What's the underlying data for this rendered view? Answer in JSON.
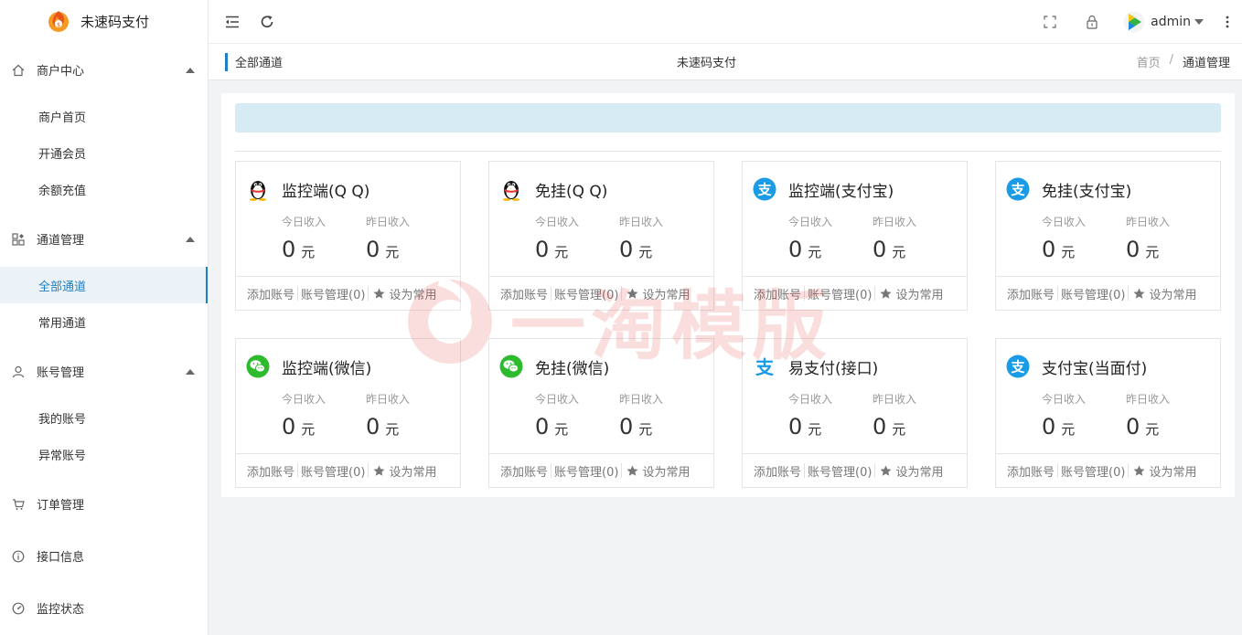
{
  "brand": {
    "name": "未速码支付",
    "logo": "flame-coin-logo"
  },
  "sidebar": {
    "groups": [
      {
        "label": "商户中心",
        "icon": "home-icon",
        "items": [
          "商户首页",
          "开通会员",
          "余额充值"
        ]
      },
      {
        "label": "通道管理",
        "icon": "grid-icon",
        "items": [
          "全部通道",
          "常用通道"
        ]
      },
      {
        "label": "账号管理",
        "icon": "user-icon",
        "items": [
          "我的账号",
          "异常账号"
        ]
      },
      {
        "label": "订单管理",
        "icon": "cart-icon"
      },
      {
        "label": "接口信息",
        "icon": "info-icon"
      },
      {
        "label": "监控状态",
        "icon": "gauge-icon"
      }
    ],
    "active_item": "全部通道"
  },
  "topbar": {
    "user": "admin",
    "icons": [
      "menu-fold-icon",
      "refresh-icon",
      "fullscreen-icon",
      "lock-icon",
      "more-vertical-icon"
    ]
  },
  "crumbbar": {
    "tag": "全部通道",
    "center_title": "未速码支付",
    "breadcrumb": [
      "首页",
      "通道管理"
    ],
    "separator": "/"
  },
  "card_labels": {
    "today": "今日收入",
    "yesterday": "昨日收入",
    "unit": "元",
    "add": "添加账号",
    "manage": "账号管理(0)",
    "favorite": "设为常用"
  },
  "cards": [
    {
      "title": "监控端(Q Q)",
      "icon": "qq-penguin-icon",
      "today": "0",
      "yesterday": "0"
    },
    {
      "title": "免挂(Q Q)",
      "icon": "qq-penguin-icon",
      "today": "0",
      "yesterday": "0"
    },
    {
      "title": "监控端(支付宝)",
      "icon": "alipay-icon",
      "today": "0",
      "yesterday": "0"
    },
    {
      "title": "免挂(支付宝)",
      "icon": "alipay-icon",
      "today": "0",
      "yesterday": "0"
    },
    {
      "title": "监控端(微信)",
      "icon": "wechat-icon",
      "today": "0",
      "yesterday": "0"
    },
    {
      "title": "免挂(微信)",
      "icon": "wechat-icon",
      "today": "0",
      "yesterday": "0"
    },
    {
      "title": "易支付(接口)",
      "icon": "epay-icon",
      "today": "0",
      "yesterday": "0"
    },
    {
      "title": "支付宝(当面付)",
      "icon": "alipay-icon",
      "today": "0",
      "yesterday": "0"
    }
  ],
  "watermark": {
    "text": "一淘模版"
  },
  "colors": {
    "accent": "#1e7fc2",
    "alert_bg": "#d7ebf5",
    "alipay": "#1a9be5",
    "wechat": "#2dbb2d"
  }
}
